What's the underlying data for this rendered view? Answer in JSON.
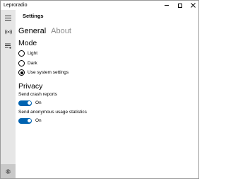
{
  "window": {
    "title": "Leproradio"
  },
  "sidebar": {
    "items": [
      {
        "icon": "hamburger-menu-icon"
      },
      {
        "icon": "radio-broadcast-icon"
      },
      {
        "icon": "playlist-icon"
      },
      {
        "icon": "gear-icon"
      }
    ]
  },
  "page": {
    "title": "Settings",
    "tabs": [
      {
        "label": "General",
        "active": true
      },
      {
        "label": "About",
        "active": false
      }
    ]
  },
  "mode": {
    "heading": "Mode",
    "options": [
      {
        "label": "Light",
        "selected": false
      },
      {
        "label": "Dark",
        "selected": false
      },
      {
        "label": "Use system settings",
        "selected": true
      }
    ]
  },
  "privacy": {
    "heading": "Privacy",
    "crash_reports": {
      "label": "Send crash reports",
      "state": "On",
      "on": true
    },
    "usage_statistics": {
      "label": "Send anonymous usage statistics",
      "state": "On",
      "on": true
    }
  },
  "colors": {
    "accent": "#0063b1",
    "sidebar_bg": "#e6e6e6",
    "selected_nav_bg": "#c9c9c9",
    "inactive_tab_text": "#8a8a8a"
  }
}
